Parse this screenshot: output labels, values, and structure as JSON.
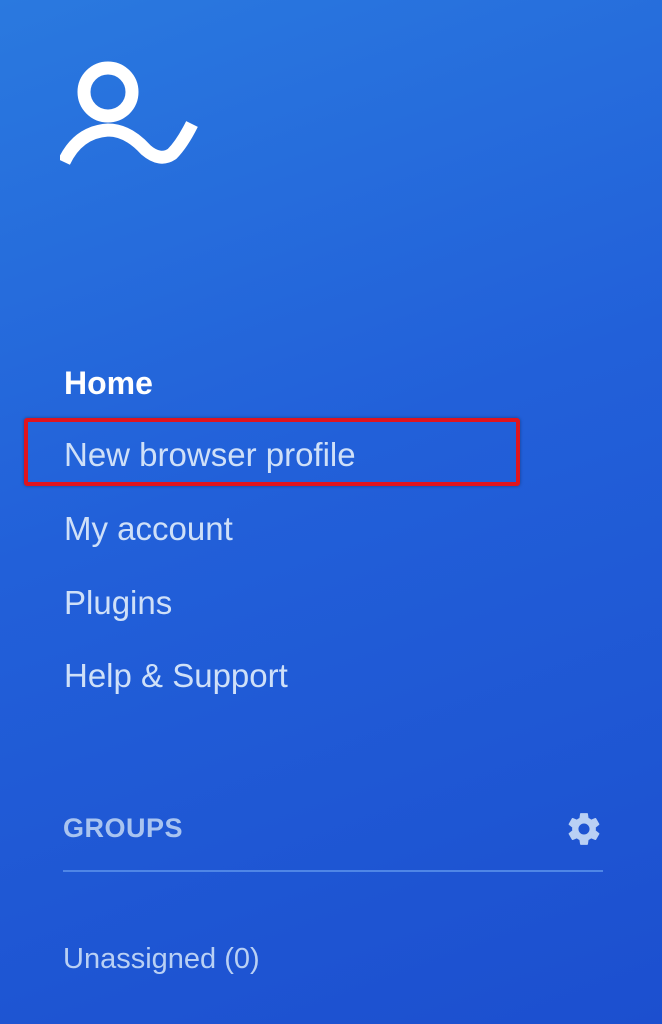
{
  "brand": {
    "logo_icon": "person-check-icon"
  },
  "nav": {
    "items": [
      {
        "label": "Home",
        "active": true
      },
      {
        "label": "New browser profile",
        "highlighted": true
      },
      {
        "label": "My account"
      },
      {
        "label": "Plugins"
      },
      {
        "label": "Help & Support"
      }
    ]
  },
  "groups": {
    "title": "GROUPS",
    "settings_icon": "gear-icon",
    "items": [
      {
        "label": "Unassigned (0)"
      }
    ]
  },
  "colors": {
    "background_start": "#2a79df",
    "background_end": "#1c4fcf",
    "highlight": "#e0141e",
    "nav_text": "#cfe0f8",
    "active_text": "#ffffff"
  }
}
